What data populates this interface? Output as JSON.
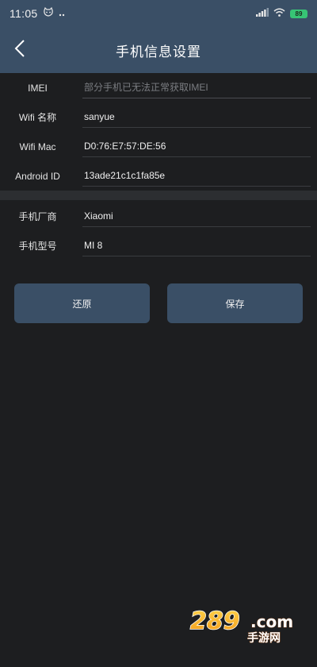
{
  "status_bar": {
    "time": "11:05",
    "battery": "89"
  },
  "app_bar": {
    "title": "手机信息设置"
  },
  "form": {
    "rows_top": [
      {
        "label": "IMEI",
        "value": "",
        "placeholder": "部分手机已无法正常获取IMEI"
      },
      {
        "label": "Wifi 名称",
        "value": "sanyue",
        "placeholder": ""
      },
      {
        "label": "Wifi Mac",
        "value": "D0:76:E7:57:DE:56",
        "placeholder": ""
      },
      {
        "label": "Android ID",
        "value": "13ade21c1c1fa85e",
        "placeholder": ""
      }
    ],
    "rows_bottom": [
      {
        "label": "手机厂商",
        "value": "Xiaomi",
        "placeholder": ""
      },
      {
        "label": "手机型号",
        "value": "MI 8",
        "placeholder": ""
      }
    ]
  },
  "buttons": {
    "reset_label": "还原",
    "save_label": "保存"
  },
  "watermark": {
    "logo_text": "289.com",
    "sub_text": "手游网"
  },
  "colors": {
    "primary": "#3a4f66",
    "background": "#1d1e20",
    "battery": "#37c475"
  }
}
